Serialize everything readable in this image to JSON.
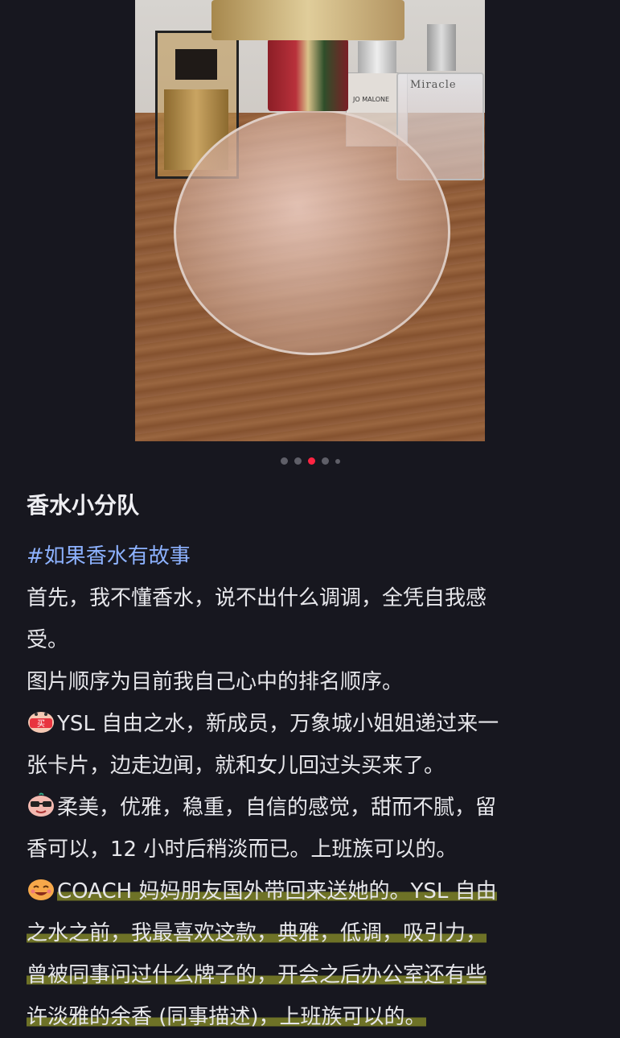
{
  "photo": {
    "bottle_label_right": "Miracle",
    "bottle_label_middle": "JO MALONE"
  },
  "carousel": {
    "count": 5,
    "active_index": 2
  },
  "post": {
    "title": "香水小分队",
    "hashtag": "#如果香水有故事",
    "lines": [
      "首先，我不懂香水，说不出什么调调，全凭自我感",
      "受。",
      "图片顺序为目前我自己心中的排名顺序。",
      "YSL 自由之水，新成员，万象城小姐姐递过来一",
      "张卡片，边走边闻，就和女儿回过头买来了。",
      "柔美，优雅，稳重，自信的感觉，甜而不腻，留",
      "香可以，12 小时后稍淡而已。上班族可以的。",
      "COACH 妈妈朋友国外带回来送她的。YSL 自由",
      "之水之前，我最喜欢这款，典雅，低调，吸引力，",
      "曾被同事问过什么牌子的，开会之后办公室还有些",
      "许淡雅的余香 (同事描述)，上班族可以的。"
    ]
  },
  "icons": {
    "buy": "buy-sticker-icon",
    "cool": "sunglasses-face-icon",
    "happy": "happy-face-icon"
  }
}
